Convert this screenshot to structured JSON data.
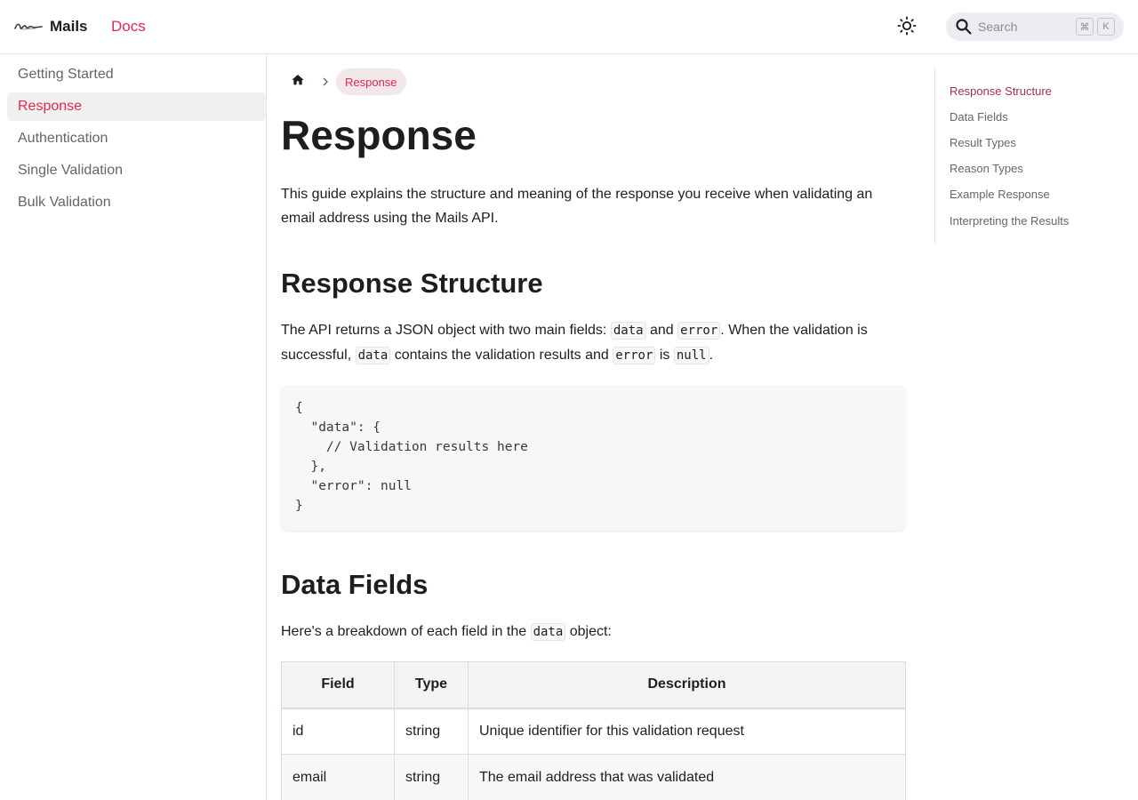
{
  "navbar": {
    "brand_title": "Mails",
    "docs_link": "Docs",
    "search_placeholder": "Search",
    "shortcut_keys": [
      "⌘",
      "K"
    ]
  },
  "sidebar": {
    "items": [
      {
        "label": "Getting Started",
        "active": false
      },
      {
        "label": "Response",
        "active": true
      },
      {
        "label": "Authentication",
        "active": false
      },
      {
        "label": "Single Validation",
        "active": false
      },
      {
        "label": "Bulk Validation",
        "active": false
      }
    ]
  },
  "breadcrumb": {
    "current": "Response"
  },
  "content": {
    "title": "Response",
    "intro": "This guide explains the structure and meaning of the response you receive when validating an email address using the Mails API.",
    "section1_title": "Response Structure",
    "section1_text": {
      "p1": "The API returns a JSON object with two main fields: ",
      "c1": "data",
      "p2": " and ",
      "c2": "error",
      "p3": ". When the validation is successful, ",
      "c3": "data",
      "p4": " contains the validation results and ",
      "c4": "error",
      "p5": " is ",
      "c5": "null",
      "p6": "."
    },
    "code_sample": "{\n  \"data\": {\n    // Validation results here\n  },\n  \"error\": null\n}",
    "section2_title": "Data Fields",
    "section2_text": {
      "p1": "Here's a breakdown of each field in the ",
      "c1": "data",
      "p2": " object:"
    },
    "table": {
      "headers": [
        "Field",
        "Type",
        "Description"
      ],
      "rows": [
        [
          "id",
          "string",
          "Unique identifier for this validation request"
        ],
        [
          "email",
          "string",
          "The email address that was validated"
        ]
      ]
    }
  },
  "toc": {
    "items": [
      {
        "label": "Response Structure",
        "active": true
      },
      {
        "label": "Data Fields",
        "active": false
      },
      {
        "label": "Result Types",
        "active": false
      },
      {
        "label": "Reason Types",
        "active": false
      },
      {
        "label": "Example Response",
        "active": false
      },
      {
        "label": "Interpreting the Results",
        "active": false
      }
    ]
  },
  "colors": {
    "accent": "#e0294f",
    "toc_active": "#a7314f",
    "text": "#1c1e21",
    "muted": "#606770"
  },
  "icons": {
    "theme_toggle": "sun-icon",
    "search": "search-icon",
    "home": "home-icon",
    "separator": "chevron-right-icon",
    "logo": "signature-logo"
  }
}
